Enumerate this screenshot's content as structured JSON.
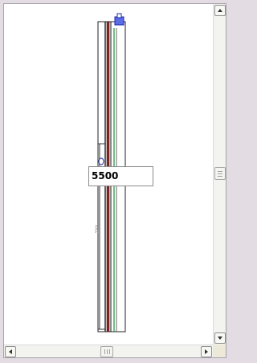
{
  "window": {
    "dimension_value": "5500",
    "vertical_dim_text": "5500"
  },
  "colors": {
    "wall_red": "#8b1a1a",
    "wall_dark": "#2e2e2e",
    "wall_green": "#1c8c3a",
    "handle_blue": "#2d3fd6"
  },
  "icons": {
    "scroll_up": "arrow-up-icon",
    "scroll_down": "arrow-down-icon",
    "scroll_left": "arrow-left-icon",
    "scroll_right": "arrow-right-icon"
  }
}
